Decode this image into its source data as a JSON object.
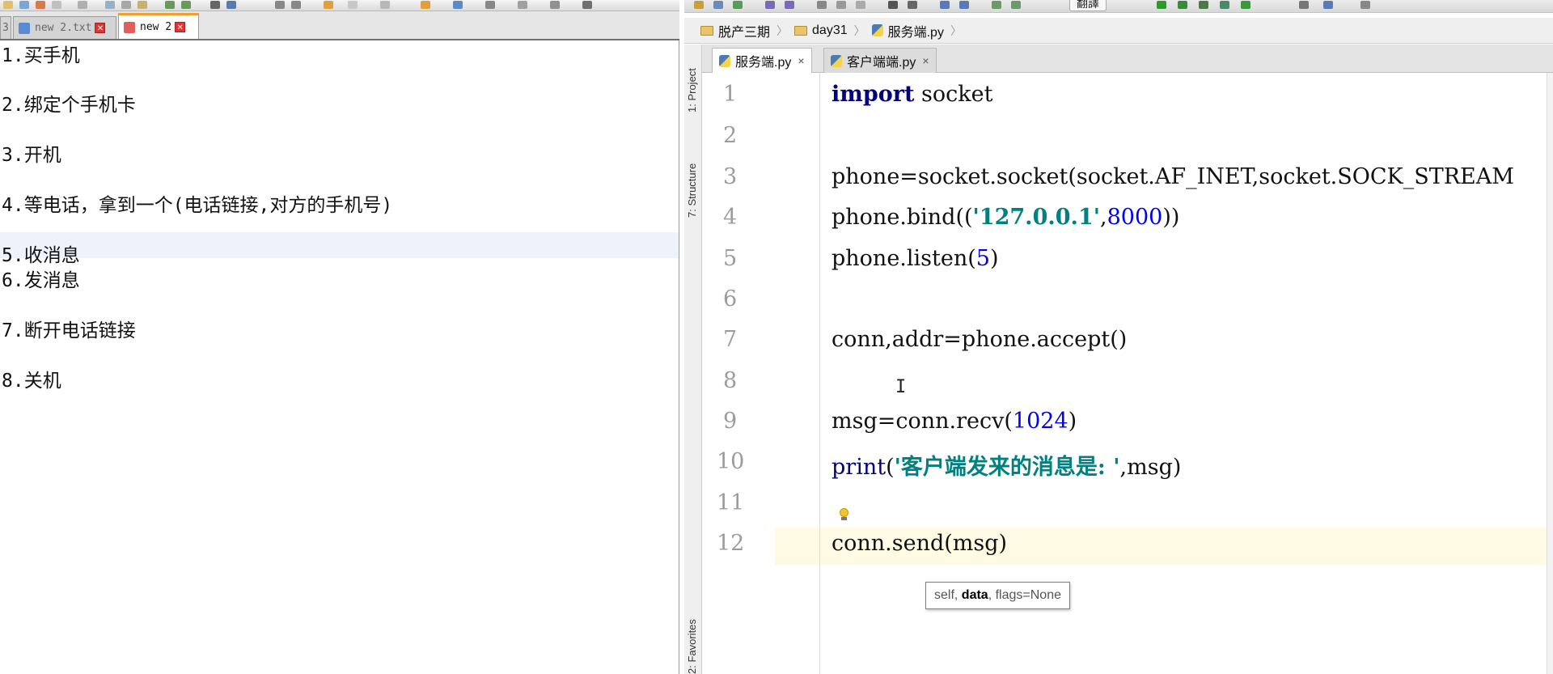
{
  "notepad": {
    "tabs": [
      {
        "label": "3",
        "active": false
      },
      {
        "label": "new 2.txt",
        "active": false
      },
      {
        "label": "new 2",
        "active": true
      }
    ],
    "lines": [
      "1.买手机",
      "2.绑定个手机卡",
      "3.开机",
      "4.等电话，拿到一个(电话链接,对方的手机号)",
      "5.收消息",
      "6.发消息",
      "7.断开电话链接",
      "8.关机"
    ],
    "close_symbol": "✕"
  },
  "ide": {
    "run_config_label": "翻譯",
    "breadcrumbs": [
      "脱产三期",
      "day31",
      "服务端.py"
    ],
    "breadcrumb_sep": "〉",
    "side_panels": [
      "1: Project",
      "7: Structure",
      "2: Favorites"
    ],
    "tabs": [
      {
        "label": "服务端.py",
        "active": true,
        "close": "×"
      },
      {
        "label": "客户端端.py",
        "active": false,
        "close": "×"
      }
    ],
    "line_numbers": [
      "1",
      "2",
      "3",
      "4",
      "5",
      "6",
      "7",
      "8",
      "9",
      "10",
      "11",
      "12"
    ],
    "code": {
      "l1_kw": "import",
      "l1_rest": " socket",
      "l3": "phone=socket.socket(socket.AF_INET,socket.SOCK_STREAM",
      "l4_a": "phone.bind((",
      "l4_str": "'127.0.0.1'",
      "l4_b": ",",
      "l4_num": "8000",
      "l4_c": "))",
      "l5_a": "phone.listen(",
      "l5_num": "5",
      "l5_b": ")",
      "l7": "conn,addr=phone.accept()",
      "l9_a": "msg=conn.recv(",
      "l9_num": "1024",
      "l9_b": ")",
      "l10_fn": "print",
      "l10_a": "(",
      "l10_str": "'客户端发来的消息是: '",
      "l10_b": ",msg)",
      "l12": "conn.send(msg)"
    },
    "current_line": 12,
    "text_cursor": "I",
    "param_hint": {
      "pre": "self, ",
      "current": "data",
      "post": ", flags=None"
    }
  },
  "colors": {
    "keyword": "#000080",
    "number": "#0000ff",
    "string": "#008080",
    "current_line": "#fffae3"
  }
}
